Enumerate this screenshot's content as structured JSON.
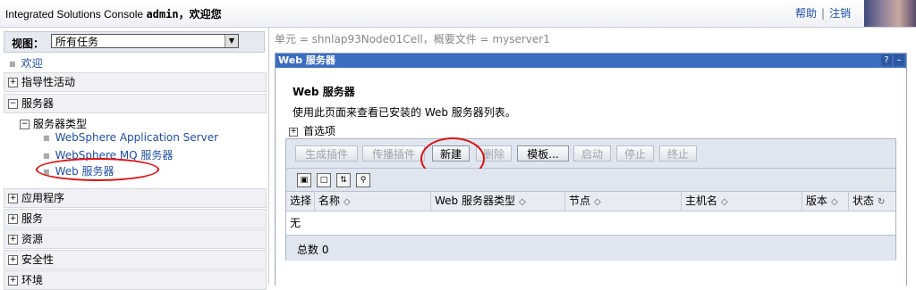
{
  "header": {
    "app_title": "Integrated Solutions Console",
    "user": "admin，欢迎您",
    "help": "帮助",
    "separator": "|",
    "logout": "注销"
  },
  "nav": {
    "view_label": "视图：",
    "view_value": "所有任务",
    "welcome": "欢迎",
    "sections": {
      "guided": "指导性活动",
      "servers": "服务器",
      "server_types": "服务器类型",
      "was": "WebSphere Application Server",
      "mq": "WebSphere MQ 服务器",
      "web_servers": "Web 服务器",
      "applications": "应用程序",
      "services": "服务",
      "resources": "资源",
      "security": "安全性",
      "environment": "环境"
    }
  },
  "content": {
    "breadcrumb": "单元 = shnlap93Node01Cell，概要文件 = myserver1",
    "portlet_title": "Web 服务器",
    "portlet_help": "?",
    "portlet_min": "–",
    "heading": "Web 服务器",
    "description": "使用此页面来查看已安装的 Web 服务器列表。",
    "preferences": "首选项",
    "buttons": {
      "gen_plugin": "生成插件",
      "propagate_plugin": "传播插件",
      "new": "新建",
      "delete": "删除",
      "template": "模板...",
      "start": "启动",
      "stop": "停止",
      "terminate": "终止"
    },
    "columns": {
      "select": "选择",
      "name": "名称",
      "type": "Web 服务器类型",
      "node": "节点",
      "host": "主机名",
      "version": "版本",
      "status": "状态"
    },
    "empty_text": "无",
    "total": "总数 0"
  },
  "colors": {
    "title_bar": "#3d6dbf",
    "link": "#1f4fa5",
    "annotation": "#dd1111"
  }
}
